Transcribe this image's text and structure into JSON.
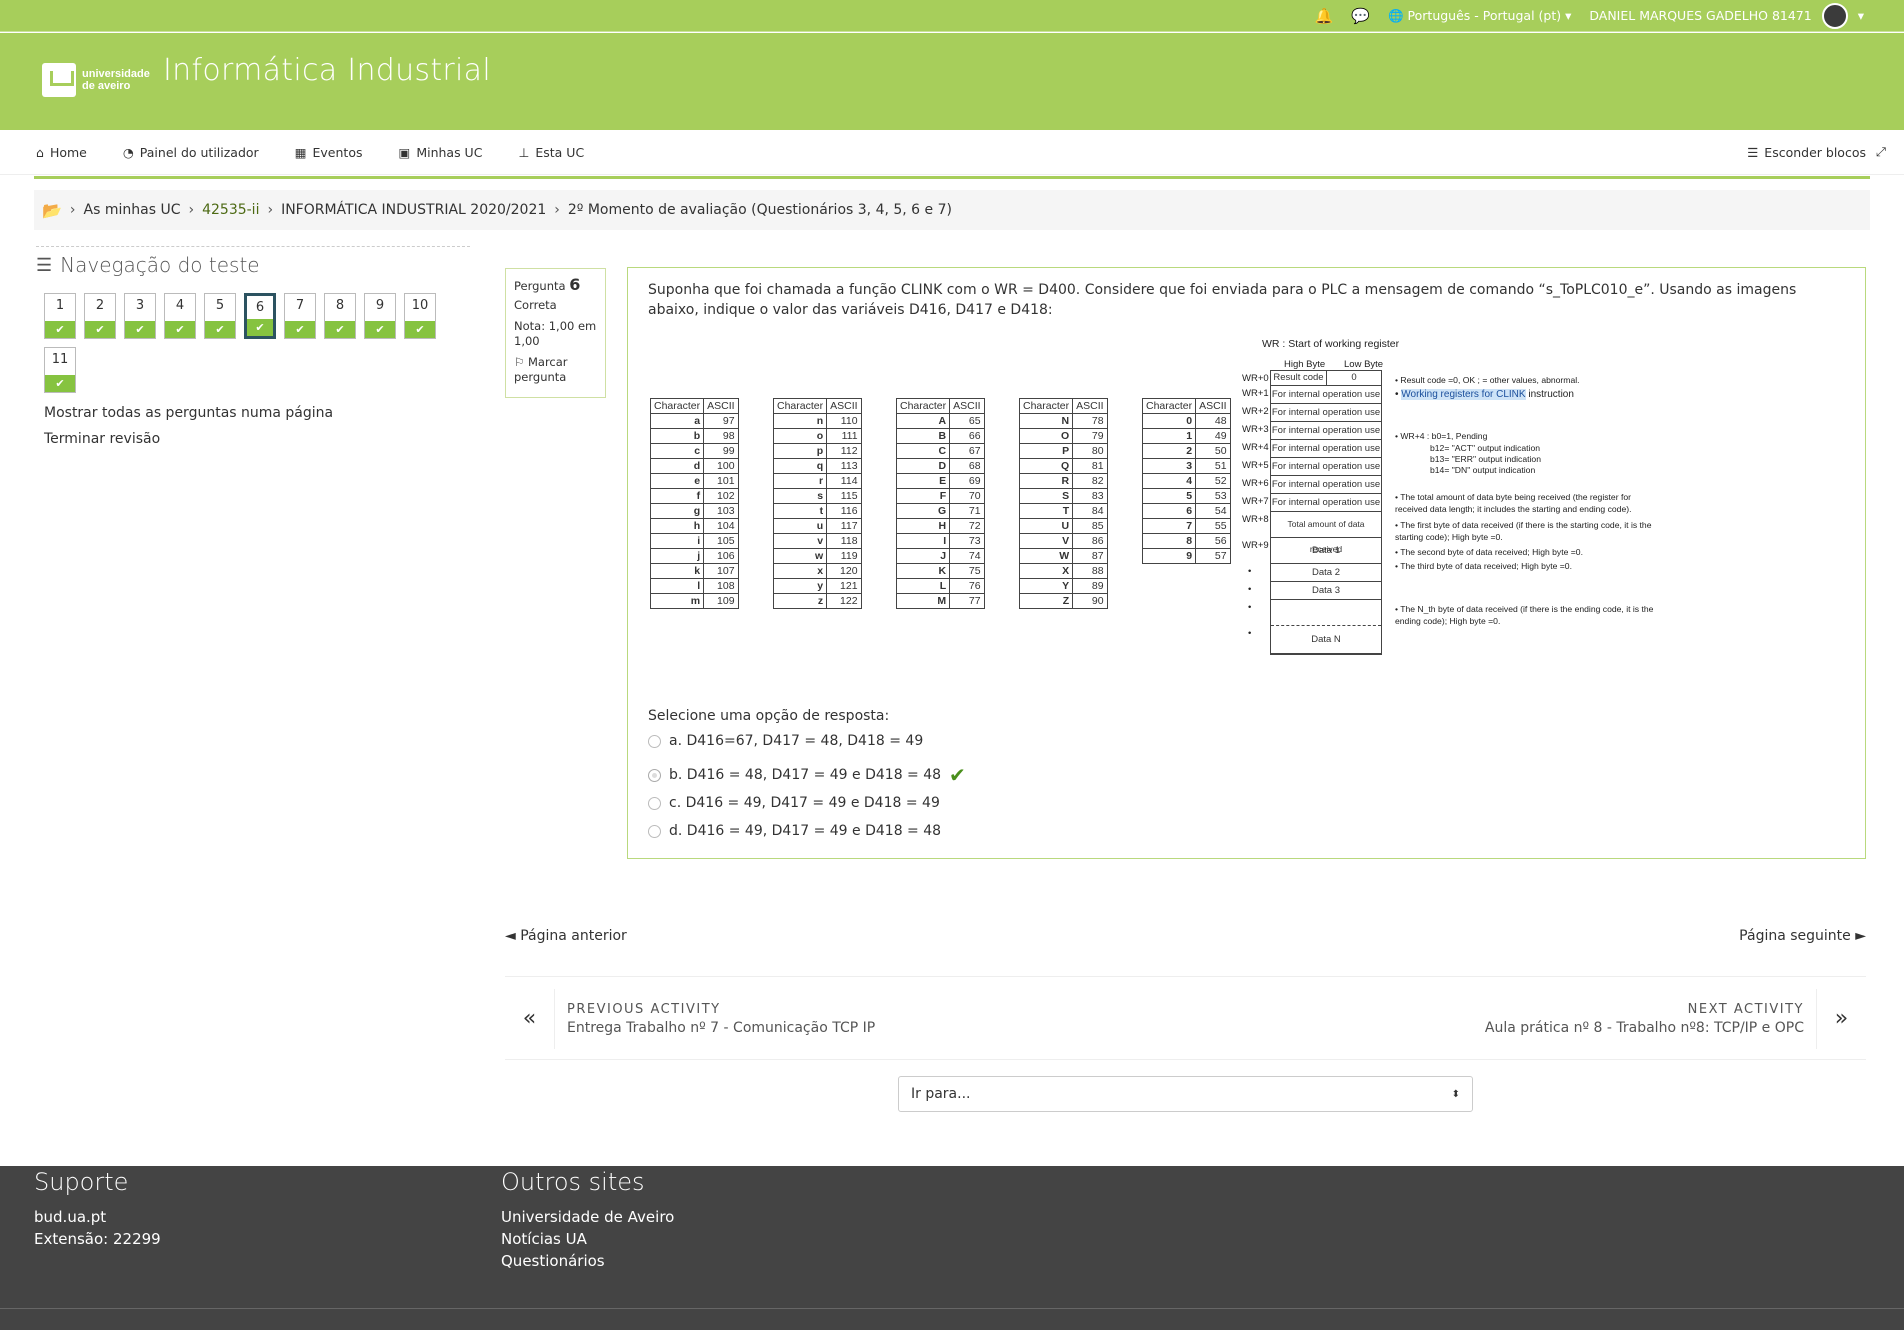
{
  "topbar": {
    "language": "Português - Portugal (pt)",
    "user": "DANIEL MARQUES GADELHO 81471"
  },
  "header": {
    "logo_line1": "universidade",
    "logo_line2": "de aveiro",
    "site_title": "Informática Industrial"
  },
  "nav": {
    "home": "Home",
    "dashboard": "Painel do utilizador",
    "events": "Eventos",
    "my_courses": "Minhas UC",
    "this_course": "Esta UC",
    "hide_blocks": "Esconder blocos"
  },
  "breadcrumb": {
    "items": [
      "As minhas UC",
      "42535-ii",
      "INFORMÁTICA INDUSTRIAL 2020/2021",
      "2º Momento de avaliação (Questionários 3, 4, 5, 6 e 7)"
    ]
  },
  "quiz_nav": {
    "title": "Navegação do teste",
    "questions": [
      "1",
      "2",
      "3",
      "4",
      "5",
      "6",
      "7",
      "8",
      "9",
      "10",
      "11"
    ],
    "current": "6",
    "show_all": "Mostrar todas as perguntas numa página",
    "finish": "Terminar revisão"
  },
  "qinfo": {
    "label": "Pergunta",
    "number": "6",
    "state": "Correta",
    "grade": "Nota: 1,00 em 1,00",
    "flag": "Marcar pergunta"
  },
  "question": {
    "text": "Suponha que foi chamada a função CLINK com o WR = D400. Considere que foi enviada para o PLC a mensagem de comando “s_ToPLC010_e”. Usando as imagens abaixo, indique o valor das variáveis D416, D417 e D418:",
    "prompt": "Selecione uma opção de resposta:",
    "options": [
      {
        "label": "a. D416=67, D417 = 48, D418 = 49"
      },
      {
        "label": "b. D416 = 48, D417 = 49 e D418 = 48"
      },
      {
        "label": "c. D416 = 49, D417 = 49 e D418 = 49"
      },
      {
        "label": "d. D416 = 49, D417 = 49 e D418 = 48"
      }
    ]
  },
  "ascii_tables": [
    [
      [
        "a",
        "97"
      ],
      [
        "b",
        "98"
      ],
      [
        "c",
        "99"
      ],
      [
        "d",
        "100"
      ],
      [
        "e",
        "101"
      ],
      [
        "f",
        "102"
      ],
      [
        "g",
        "103"
      ],
      [
        "h",
        "104"
      ],
      [
        "i",
        "105"
      ],
      [
        "j",
        "106"
      ],
      [
        "k",
        "107"
      ],
      [
        "l",
        "108"
      ],
      [
        "m",
        "109"
      ]
    ],
    [
      [
        "n",
        "110"
      ],
      [
        "o",
        "111"
      ],
      [
        "p",
        "112"
      ],
      [
        "q",
        "113"
      ],
      [
        "r",
        "114"
      ],
      [
        "s",
        "115"
      ],
      [
        "t",
        "116"
      ],
      [
        "u",
        "117"
      ],
      [
        "v",
        "118"
      ],
      [
        "w",
        "119"
      ],
      [
        "x",
        "120"
      ],
      [
        "y",
        "121"
      ],
      [
        "z",
        "122"
      ]
    ],
    [
      [
        "A",
        "65"
      ],
      [
        "B",
        "66"
      ],
      [
        "C",
        "67"
      ],
      [
        "D",
        "68"
      ],
      [
        "E",
        "69"
      ],
      [
        "F",
        "70"
      ],
      [
        "G",
        "71"
      ],
      [
        "H",
        "72"
      ],
      [
        "I",
        "73"
      ],
      [
        "J",
        "74"
      ],
      [
        "K",
        "75"
      ],
      [
        "L",
        "76"
      ],
      [
        "M",
        "77"
      ]
    ],
    [
      [
        "N",
        "78"
      ],
      [
        "O",
        "79"
      ],
      [
        "P",
        "80"
      ],
      [
        "Q",
        "81"
      ],
      [
        "R",
        "82"
      ],
      [
        "S",
        "83"
      ],
      [
        "T",
        "84"
      ],
      [
        "U",
        "85"
      ],
      [
        "V",
        "86"
      ],
      [
        "W",
        "87"
      ],
      [
        "X",
        "88"
      ],
      [
        "Y",
        "89"
      ],
      [
        "Z",
        "90"
      ]
    ],
    [
      [
        "0",
        "48"
      ],
      [
        "1",
        "49"
      ],
      [
        "2",
        "50"
      ],
      [
        "3",
        "51"
      ],
      [
        "4",
        "52"
      ],
      [
        "5",
        "53"
      ],
      [
        "6",
        "54"
      ],
      [
        "7",
        "55"
      ],
      [
        "8",
        "56"
      ],
      [
        "9",
        "57"
      ]
    ]
  ],
  "ascii_headers": {
    "char": "Character",
    "ascii": "ASCII"
  },
  "wr_diagram": {
    "title": "WR : Start of working register",
    "high": "High Byte",
    "low": "Low Byte",
    "rows": [
      {
        "label": "WR+0",
        "cells": [
          "Result code",
          "0"
        ]
      },
      {
        "label": "WR+1",
        "cells": [
          "For internal operation use"
        ]
      },
      {
        "label": "WR+2",
        "cells": [
          "For internal operation use"
        ]
      },
      {
        "label": "WR+3",
        "cells": [
          "For internal operation use"
        ]
      },
      {
        "label": "WR+4",
        "cells": [
          "For internal operation use"
        ]
      },
      {
        "label": "WR+5",
        "cells": [
          "For internal operation use"
        ]
      },
      {
        "label": "WR+6",
        "cells": [
          "For internal operation use"
        ]
      },
      {
        "label": "WR+7",
        "cells": [
          "For internal operation use"
        ]
      },
      {
        "label": "WR+8",
        "cells": [
          "Total amount of data received"
        ]
      },
      {
        "label": "WR+9",
        "cells": [
          "Data 1"
        ]
      },
      {
        "label": "",
        "cells": [
          "Data 2"
        ]
      },
      {
        "label": "",
        "cells": [
          "Data 3"
        ]
      },
      {
        "label": "",
        "cells": [
          ""
        ]
      },
      {
        "label": "",
        "cells": [
          "Data N"
        ]
      }
    ],
    "notes": [
      "• Result code =0, OK ; = other values, abnormal.",
      "• Working registers for CLINK instruction",
      "• WR+4 : b0=1, Pending",
      "b12= \"ACT\" output indication",
      "b13= \"ERR\" output indication",
      "b14= \"DN\" output indication",
      "• The total amount of data byte being received (the register for received data length; it includes the starting and ending code).",
      "• The first byte of data received (if there is the starting code, it is the starting code); High byte =0.",
      "• The second byte of data received; High byte =0.",
      "• The third byte of data received; High byte =0.",
      "• The N_th byte of data received (if there is the ending code, it is the ending code); High byte =0."
    ]
  },
  "page_nav": {
    "prev": "◄ Página anterior",
    "next": "Página seguinte ►"
  },
  "activity_nav": {
    "prev_label": "PREVIOUS ACTIVITY",
    "prev_title": "Entrega Trabalho nº 7 - Comunicação TCP IP",
    "next_label": "NEXT ACTIVITY",
    "next_title": "Aula prática nº 8 - Trabalho nº8: TCP/IP e OPC"
  },
  "jump": {
    "placeholder": "Ir para..."
  },
  "footer": {
    "support_title": "Suporte",
    "support_lines": [
      "bud.ua.pt",
      "Extensão: 22299"
    ],
    "other_title": "Outros sites",
    "other_lines": [
      "Universidade de Aveiro",
      "Notícias UA",
      "Questionários"
    ]
  },
  "colors": {
    "brand": "#a7ce5b",
    "correct": "#86c340",
    "footer": "#444444"
  }
}
